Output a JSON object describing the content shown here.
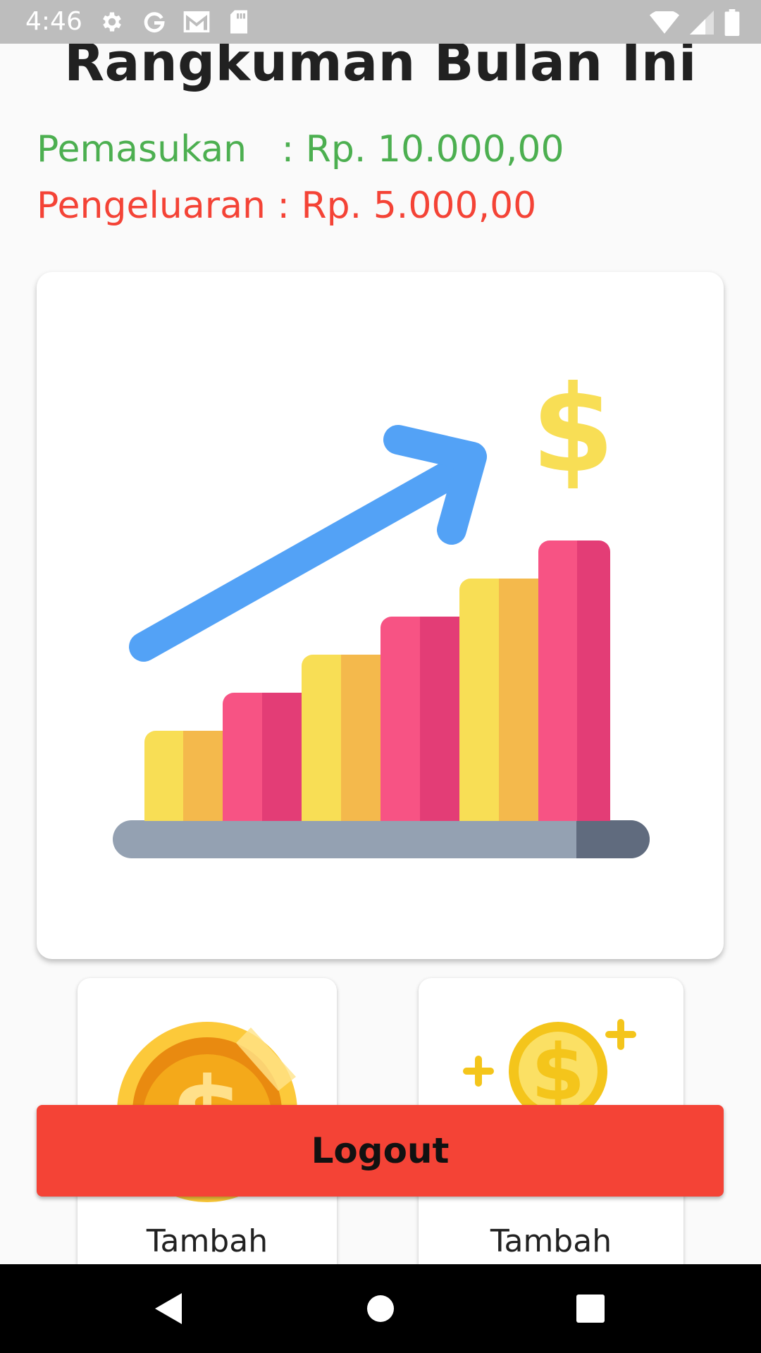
{
  "status_bar": {
    "time": "4:46",
    "icons_left": [
      "gear-icon",
      "google-icon",
      "gmail-icon",
      "sd-card-icon"
    ],
    "icons_right": [
      "wifi-icon",
      "cell-signal-icon",
      "battery-icon"
    ]
  },
  "summary": {
    "title": "Rangkuman Bulan Ini",
    "income_line": "Pemasukan   : Rp. 10.000,00",
    "expense_line": "Pengeluaran : Rp. 5.000,00",
    "income_color": "#4caf50",
    "expense_color": "#f44336"
  },
  "illustration": {
    "icons": [
      "growth-chart-illustration",
      "dollar-sign-icon",
      "trend-arrow-icon"
    ]
  },
  "menu": {
    "cards": [
      {
        "label": "Tambah",
        "icon": "gold-coin-icon"
      },
      {
        "label": "Tambah",
        "icon": "coin-sparkle-icon"
      }
    ]
  },
  "logout": {
    "label": "Logout",
    "color": "#f44336"
  },
  "nav_bar": {
    "buttons": [
      "back-icon",
      "home-icon",
      "recents-icon"
    ]
  }
}
